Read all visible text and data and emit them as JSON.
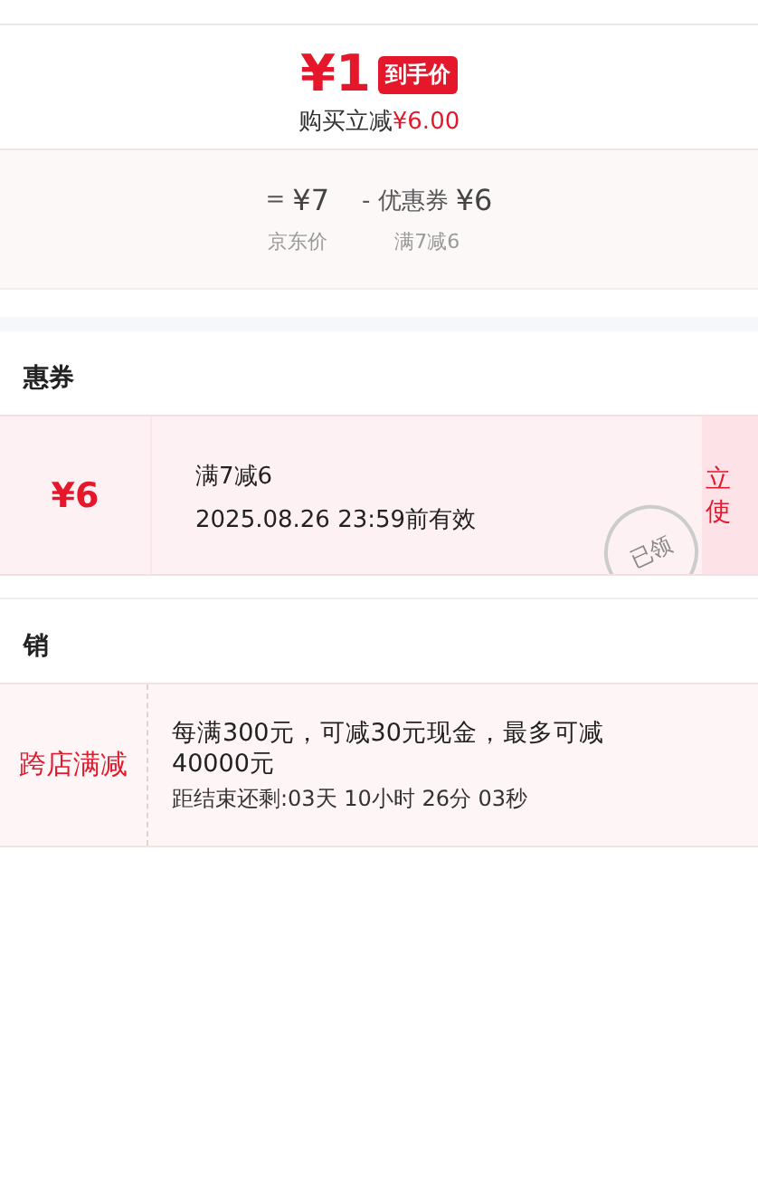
{
  "price": {
    "final": "¥1",
    "badge": "到手价",
    "saving_label": "购买立减",
    "saving_amount": "¥6.00"
  },
  "formula": [
    {
      "op": "=",
      "amount": "¥7",
      "caption": "京东价"
    },
    {
      "op": "- 优惠券",
      "amount": "¥6",
      "caption": "满7减6"
    }
  ],
  "coupon_section": {
    "title": "惠券",
    "coupons": [
      {
        "amount": "¥6",
        "condition": "满7减6",
        "validity": "2025.08.26 23:59前有效",
        "claimed": true,
        "stamp": "已领",
        "action_lines": [
          "立",
          "使"
        ]
      }
    ]
  },
  "promo_section": {
    "title": "销",
    "promotions": [
      {
        "tag": "跨店满减",
        "description": "每满300元，可减30元现金，最多可减40000元",
        "countdown": "距结束还剩:03天 10小时 26分 03秒"
      }
    ]
  }
}
